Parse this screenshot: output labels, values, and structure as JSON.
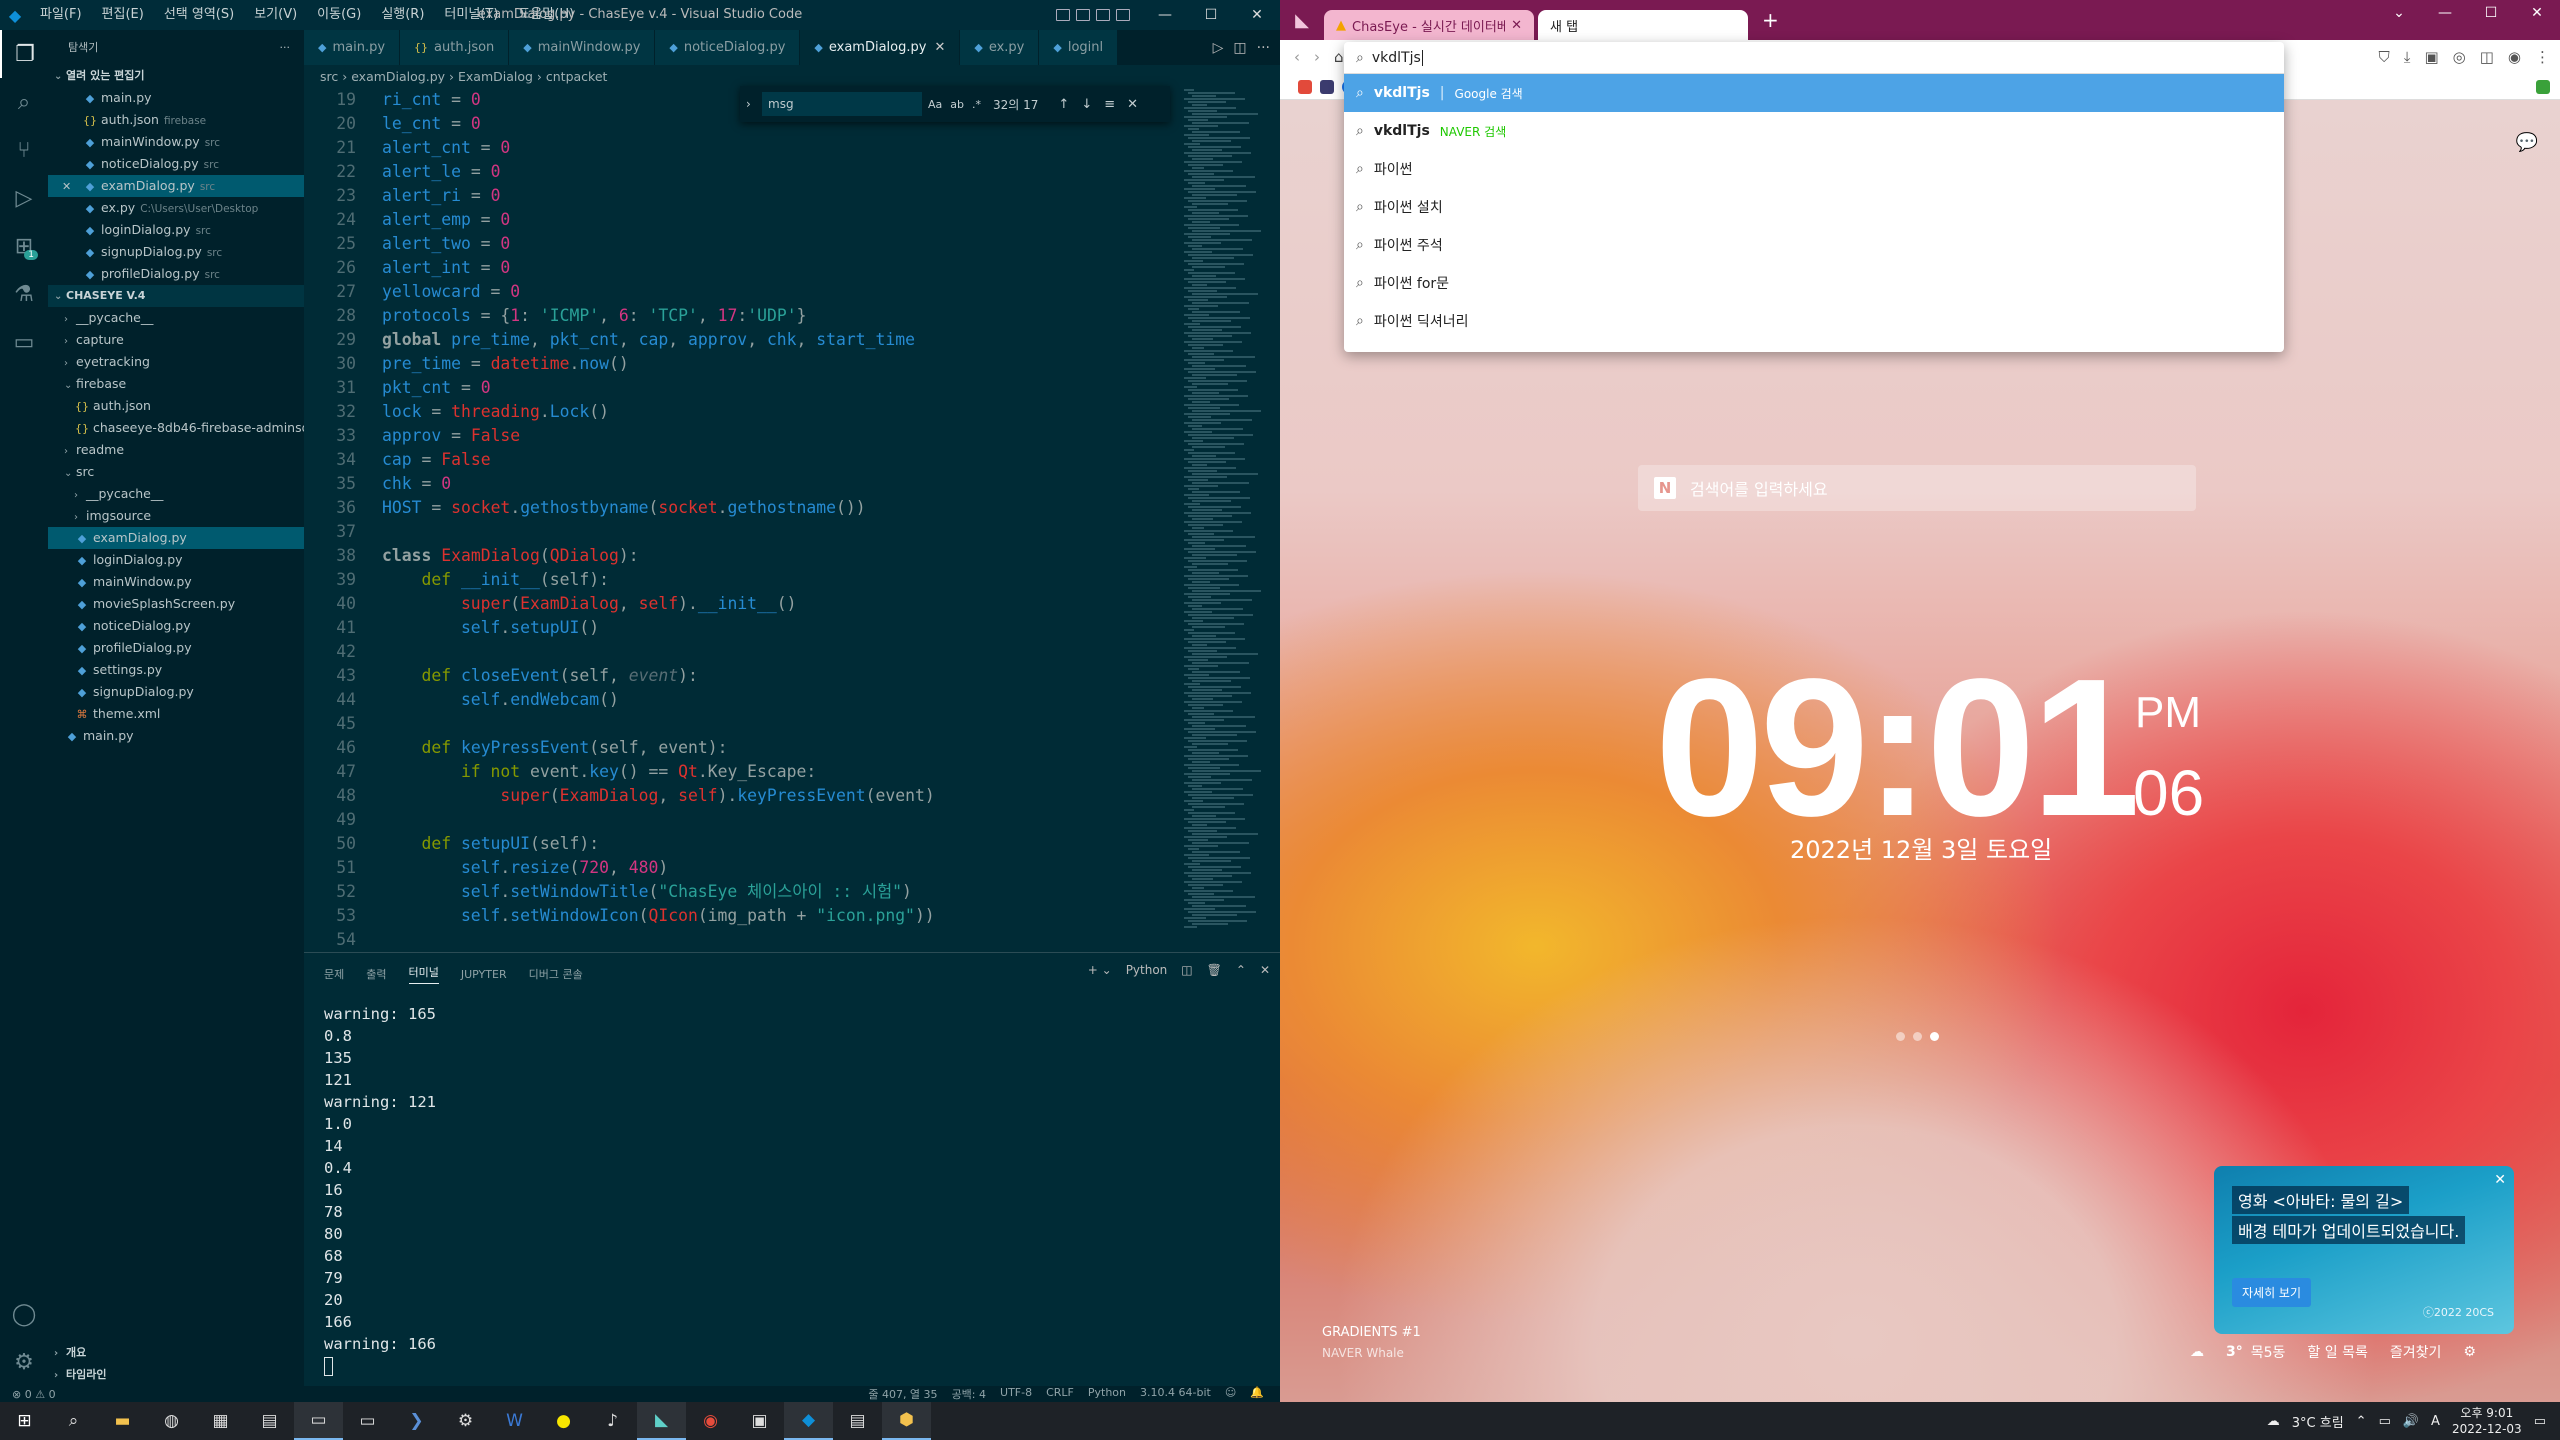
{
  "vscode": {
    "window_title": "examDialog.py - ChasEye v.4 - Visual Studio Code",
    "menu": [
      "파일(F)",
      "편집(E)",
      "선택 영역(S)",
      "보기(V)",
      "이동(G)",
      "실행(R)",
      "터미널(T)",
      "도움말(H)"
    ],
    "explorer": {
      "header": "탐색기",
      "open_editors_title": "열려 있는 편집기",
      "open_editors": [
        {
          "name": "main.py",
          "hint": "",
          "kind": "py"
        },
        {
          "name": "auth.json",
          "hint": "firebase",
          "kind": "json"
        },
        {
          "name": "mainWindow.py",
          "hint": "src",
          "kind": "py"
        },
        {
          "name": "noticeDialog.py",
          "hint": "src",
          "kind": "py"
        },
        {
          "name": "examDialog.py",
          "hint": "src",
          "kind": "py"
        },
        {
          "name": "ex.py",
          "hint": "C:\\Users\\User\\Desktop",
          "kind": "py"
        },
        {
          "name": "loginDialog.py",
          "hint": "src",
          "kind": "py"
        },
        {
          "name": "signupDialog.py",
          "hint": "src",
          "kind": "py"
        },
        {
          "name": "profileDialog.py",
          "hint": "src",
          "kind": "py"
        }
      ],
      "project_title": "CHASEYE V.4",
      "tree": [
        {
          "name": "__pycache__",
          "kind": "folder",
          "depth": 0,
          "open": false
        },
        {
          "name": "capture",
          "kind": "folder",
          "depth": 0,
          "open": false
        },
        {
          "name": "eyetracking",
          "kind": "folder",
          "depth": 0,
          "open": false
        },
        {
          "name": "firebase",
          "kind": "folder",
          "depth": 0,
          "open": true
        },
        {
          "name": "auth.json",
          "kind": "json",
          "depth": 1
        },
        {
          "name": "chaseeye-8db46-firebase-adminsd...",
          "kind": "json",
          "depth": 1
        },
        {
          "name": "readme",
          "kind": "folder",
          "depth": 0,
          "open": false
        },
        {
          "name": "src",
          "kind": "folder",
          "depth": 0,
          "open": true
        },
        {
          "name": "__pycache__",
          "kind": "folder",
          "depth": 1,
          "open": false
        },
        {
          "name": "imgsource",
          "kind": "folder",
          "depth": 1,
          "open": false
        },
        {
          "name": "examDialog.py",
          "kind": "py",
          "depth": 1
        },
        {
          "name": "loginDialog.py",
          "kind": "py",
          "depth": 1
        },
        {
          "name": "mainWindow.py",
          "kind": "py",
          "depth": 1
        },
        {
          "name": "movieSplashScreen.py",
          "kind": "py",
          "depth": 1
        },
        {
          "name": "noticeDialog.py",
          "kind": "py",
          "depth": 1
        },
        {
          "name": "profileDialog.py",
          "kind": "py",
          "depth": 1
        },
        {
          "name": "settings.py",
          "kind": "py",
          "depth": 1
        },
        {
          "name": "signupDialog.py",
          "kind": "py",
          "depth": 1
        },
        {
          "name": "theme.xml",
          "kind": "xml",
          "depth": 1
        },
        {
          "name": "main.py",
          "kind": "py",
          "depth": 0
        }
      ],
      "outline": "개요",
      "timeline": "타임라인"
    },
    "tabs": [
      {
        "label": "main.py",
        "kind": "py"
      },
      {
        "label": "auth.json",
        "kind": "json"
      },
      {
        "label": "mainWindow.py",
        "kind": "py"
      },
      {
        "label": "noticeDialog.py",
        "kind": "py"
      },
      {
        "label": "examDialog.py",
        "kind": "py"
      },
      {
        "label": "ex.py",
        "kind": "py"
      },
      {
        "label": "loginl",
        "kind": "py"
      }
    ],
    "breadcrumb": [
      "src",
      "examDialog.py",
      "ExamDialog",
      "cntpacket"
    ],
    "find": {
      "query": "msg",
      "count": "32의 17"
    },
    "code": [
      {
        "n": "19",
        "t": [
          [
            "ri_cnt",
            "v"
          ],
          [
            " = ",
            "p"
          ],
          [
            "0",
            "n"
          ]
        ]
      },
      {
        "n": "20",
        "t": [
          [
            "le_cnt",
            "v"
          ],
          [
            " = ",
            "p"
          ],
          [
            "0",
            "n"
          ]
        ]
      },
      {
        "n": "21",
        "t": [
          [
            "alert_cnt",
            "v"
          ],
          [
            " = ",
            "p"
          ],
          [
            "0",
            "n"
          ]
        ]
      },
      {
        "n": "22",
        "t": [
          [
            "alert_le",
            "v"
          ],
          [
            " = ",
            "p"
          ],
          [
            "0",
            "n"
          ]
        ]
      },
      {
        "n": "23",
        "t": [
          [
            "alert_ri",
            "v"
          ],
          [
            " = ",
            "p"
          ],
          [
            "0",
            "n"
          ]
        ]
      },
      {
        "n": "24",
        "t": [
          [
            "alert_emp",
            "v"
          ],
          [
            " = ",
            "p"
          ],
          [
            "0",
            "n"
          ]
        ]
      },
      {
        "n": "25",
        "t": [
          [
            "alert_two",
            "v"
          ],
          [
            " = ",
            "p"
          ],
          [
            "0",
            "n"
          ]
        ]
      },
      {
        "n": "26",
        "t": [
          [
            "alert_int",
            "v"
          ],
          [
            " = ",
            "p"
          ],
          [
            "0",
            "n"
          ]
        ]
      },
      {
        "n": "27",
        "t": [
          [
            "yellowcard",
            "v"
          ],
          [
            " = ",
            "p"
          ],
          [
            "0",
            "n"
          ]
        ]
      },
      {
        "n": "28",
        "t": [
          [
            "protocols",
            "v"
          ],
          [
            " = {",
            "p"
          ],
          [
            "1",
            "n"
          ],
          [
            ": ",
            "p"
          ],
          [
            "'ICMP'",
            "s"
          ],
          [
            ", ",
            "p"
          ],
          [
            "6",
            "n"
          ],
          [
            ": ",
            "p"
          ],
          [
            "'TCP'",
            "s"
          ],
          [
            ", ",
            "p"
          ],
          [
            "17",
            "n"
          ],
          [
            ":",
            "p"
          ],
          [
            "'UDP'",
            "s"
          ],
          [
            "}",
            "p"
          ]
        ]
      },
      {
        "n": "29",
        "t": [
          [
            "global ",
            "kw2"
          ],
          [
            "pre_time",
            "v"
          ],
          [
            ", ",
            "p"
          ],
          [
            "pkt_cnt",
            "v"
          ],
          [
            ", ",
            "p"
          ],
          [
            "cap",
            "v"
          ],
          [
            ", ",
            "p"
          ],
          [
            "approv",
            "v"
          ],
          [
            ", ",
            "p"
          ],
          [
            "chk",
            "v"
          ],
          [
            ", ",
            "p"
          ],
          [
            "start_time",
            "v"
          ]
        ]
      },
      {
        "n": "30",
        "t": [
          [
            "pre_time",
            "v"
          ],
          [
            " = ",
            "p"
          ],
          [
            "datetime",
            "c"
          ],
          [
            ".",
            "p"
          ],
          [
            "now",
            "f"
          ],
          [
            "()",
            "p"
          ]
        ]
      },
      {
        "n": "31",
        "t": [
          [
            "pkt_cnt",
            "v"
          ],
          [
            " = ",
            "p"
          ],
          [
            "0",
            "n"
          ]
        ]
      },
      {
        "n": "32",
        "t": [
          [
            "lock",
            "v"
          ],
          [
            " = ",
            "p"
          ],
          [
            "threading",
            "c"
          ],
          [
            ".",
            "p"
          ],
          [
            "Lock",
            "f"
          ],
          [
            "()",
            "p"
          ]
        ]
      },
      {
        "n": "33",
        "t": [
          [
            "approv",
            "v"
          ],
          [
            " = ",
            "p"
          ],
          [
            "False",
            "c"
          ]
        ]
      },
      {
        "n": "34",
        "t": [
          [
            "cap",
            "v"
          ],
          [
            " = ",
            "p"
          ],
          [
            "False",
            "c"
          ]
        ]
      },
      {
        "n": "35",
        "t": [
          [
            "chk",
            "v"
          ],
          [
            " = ",
            "p"
          ],
          [
            "0",
            "n"
          ]
        ]
      },
      {
        "n": "36",
        "t": [
          [
            "HOST",
            "v"
          ],
          [
            " = ",
            "p"
          ],
          [
            "socket",
            "c"
          ],
          [
            ".",
            "p"
          ],
          [
            "gethostbyname",
            "f"
          ],
          [
            "(",
            "p"
          ],
          [
            "socket",
            "c"
          ],
          [
            ".",
            "p"
          ],
          [
            "gethostname",
            "f"
          ],
          [
            "())",
            "p"
          ]
        ]
      },
      {
        "n": "37",
        "t": []
      },
      {
        "n": "38",
        "t": [
          [
            "class ",
            "kw2"
          ],
          [
            "ExamDialog",
            "c"
          ],
          [
            "(",
            "p"
          ],
          [
            "QDialog",
            "c"
          ],
          [
            "):",
            "p"
          ]
        ]
      },
      {
        "n": "39",
        "t": [
          [
            "    def ",
            "k"
          ],
          [
            "__init__",
            "f"
          ],
          [
            "(",
            "p"
          ],
          [
            "self",
            "p"
          ],
          [
            "):",
            "p"
          ]
        ]
      },
      {
        "n": "40",
        "t": [
          [
            "        super",
            "c"
          ],
          [
            "(",
            "p"
          ],
          [
            "ExamDialog",
            "c"
          ],
          [
            ", ",
            "p"
          ],
          [
            "self",
            "c"
          ],
          [
            ").",
            "p"
          ],
          [
            "__init__",
            "f"
          ],
          [
            "()",
            "p"
          ]
        ]
      },
      {
        "n": "41",
        "t": [
          [
            "        self",
            "sf"
          ],
          [
            ".",
            "p"
          ],
          [
            "setupUI",
            "f"
          ],
          [
            "()",
            "p"
          ]
        ]
      },
      {
        "n": "42",
        "t": []
      },
      {
        "n": "43",
        "t": [
          [
            "    def ",
            "k"
          ],
          [
            "closeEvent",
            "f"
          ],
          [
            "(",
            "p"
          ],
          [
            "self",
            "p"
          ],
          [
            ", ",
            "p"
          ],
          [
            "event",
            "cm"
          ],
          [
            "):",
            "p"
          ]
        ]
      },
      {
        "n": "44",
        "t": [
          [
            "        self",
            "sf"
          ],
          [
            ".",
            "p"
          ],
          [
            "endWebcam",
            "f"
          ],
          [
            "()",
            "p"
          ]
        ]
      },
      {
        "n": "45",
        "t": []
      },
      {
        "n": "46",
        "t": [
          [
            "    def ",
            "k"
          ],
          [
            "keyPressEvent",
            "f"
          ],
          [
            "(",
            "p"
          ],
          [
            "self",
            "p"
          ],
          [
            ", ",
            "p"
          ],
          [
            "event",
            "p"
          ],
          [
            "):",
            "p"
          ]
        ]
      },
      {
        "n": "47",
        "t": [
          [
            "        if not ",
            "k"
          ],
          [
            "event",
            "p"
          ],
          [
            ".",
            "p"
          ],
          [
            "key",
            "f"
          ],
          [
            "() == ",
            "p"
          ],
          [
            "Qt",
            "c"
          ],
          [
            ".",
            "p"
          ],
          [
            "Key_Escape",
            "p"
          ],
          [
            ":",
            "p"
          ]
        ]
      },
      {
        "n": "48",
        "t": [
          [
            "            super",
            "c"
          ],
          [
            "(",
            "p"
          ],
          [
            "ExamDialog",
            "c"
          ],
          [
            ", ",
            "p"
          ],
          [
            "self",
            "c"
          ],
          [
            ").",
            "p"
          ],
          [
            "keyPressEvent",
            "f"
          ],
          [
            "(event)",
            "p"
          ]
        ]
      },
      {
        "n": "49",
        "t": []
      },
      {
        "n": "50",
        "t": [
          [
            "    def ",
            "k"
          ],
          [
            "setupUI",
            "f"
          ],
          [
            "(",
            "p"
          ],
          [
            "self",
            "p"
          ],
          [
            "):",
            "p"
          ]
        ]
      },
      {
        "n": "51",
        "t": [
          [
            "        self",
            "sf"
          ],
          [
            ".",
            "p"
          ],
          [
            "resize",
            "f"
          ],
          [
            "(",
            "p"
          ],
          [
            "720",
            "n"
          ],
          [
            ", ",
            "p"
          ],
          [
            "480",
            "n"
          ],
          [
            ")",
            "p"
          ]
        ]
      },
      {
        "n": "52",
        "t": [
          [
            "        self",
            "sf"
          ],
          [
            ".",
            "p"
          ],
          [
            "setWindowTitle",
            "f"
          ],
          [
            "(",
            "p"
          ],
          [
            "\"ChasEye 체이스아이 :: 시험\"",
            "s"
          ],
          [
            ")",
            "p"
          ]
        ]
      },
      {
        "n": "53",
        "t": [
          [
            "        self",
            "sf"
          ],
          [
            ".",
            "p"
          ],
          [
            "setWindowIcon",
            "f"
          ],
          [
            "(",
            "p"
          ],
          [
            "QIcon",
            "c"
          ],
          [
            "(",
            "p"
          ],
          [
            "img_path",
            "p"
          ],
          [
            " + ",
            "p"
          ],
          [
            "\"icon.png\"",
            "s"
          ],
          [
            "))",
            "p"
          ]
        ]
      },
      {
        "n": "54",
        "t": []
      }
    ],
    "panel_tabs": [
      "문제",
      "출력",
      "터미널",
      "JUPYTER",
      "디버그 콘솔"
    ],
    "panel_active": "터미널",
    "panel_python_label": "Python",
    "terminal": [
      "warning: 165",
      "0.8",
      "135",
      "121",
      "warning: 121",
      "1.0",
      "14",
      "0.4",
      "16",
      "78",
      "80",
      "68",
      "79",
      "20",
      "166",
      "warning: 166"
    ],
    "status": {
      "left": "⊗ 0 ⚠ 0",
      "pos": "줄 407, 열 35",
      "spaces": "공백: 4",
      "encoding": "UTF-8",
      "eol": "CRLF",
      "lang": "Python",
      "interp": "3.10.4 64-bit"
    }
  },
  "browser": {
    "tabs": [
      {
        "label": "ChasEye - 실시간 데이터베"
      },
      {
        "label": "새 탭"
      }
    ],
    "omnibox_value": "vkdlTjs",
    "suggestions": [
      {
        "text": "vkdlTjs",
        "src": "Google 검색",
        "bold": true,
        "highlight": true,
        "kind": "google"
      },
      {
        "text": "vkdlTjs",
        "src": "NAVER 검색",
        "bold": true,
        "highlight": false,
        "kind": "naver"
      },
      {
        "text": "파이썬",
        "src": "",
        "bold": false,
        "highlight": false
      },
      {
        "text": "파이썬 설치",
        "src": "",
        "bold": false,
        "highlight": false
      },
      {
        "text": "파이썬 주석",
        "src": "",
        "bold": false,
        "highlight": false
      },
      {
        "text": "파이썬 for문",
        "src": "",
        "bold": false,
        "highlight": false
      },
      {
        "text": "파이썬 딕셔너리",
        "src": "",
        "bold": false,
        "highlight": false
      }
    ],
    "naver_search_placeholder": "검색어를 입력하세요",
    "clock": {
      "hm": "09:01",
      "ampm": "PM",
      "sec": "06",
      "date": "2022년 12월 3일 토요일"
    },
    "promo": {
      "tag": "영화 <아바타: 물의 길>",
      "text": "배경 테마가 업데이트되었습니다.",
      "button": "자세히 보기",
      "copyright": "ⓒ2022 20CS"
    },
    "wallpaper": {
      "name": "GRADIENTS #1",
      "by": "NAVER Whale"
    },
    "bottom": {
      "weather": "3°",
      "location": "목5동",
      "todo": "할 일 목록",
      "fav": "즐겨찾기"
    }
  },
  "taskbar": {
    "weather": "3°C  흐림",
    "time": "오후 9:01",
    "date": "2022-12-03",
    "ime": "A"
  },
  "colors": {
    "vscode_bg": "#002b36",
    "sidebar_bg": "#00212b",
    "whale_tab": "#7a1a52",
    "highlight": "#4da3e6"
  }
}
